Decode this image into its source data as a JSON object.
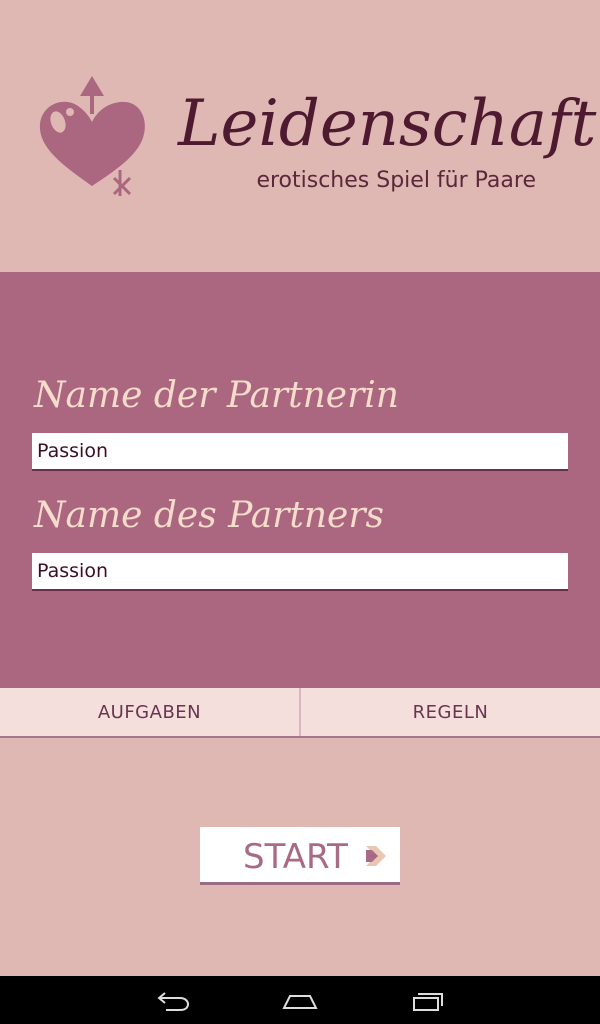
{
  "app": {
    "title": "Leidenschaft",
    "subtitle": "erotisches Spiel für Paare"
  },
  "form": {
    "partnerin_label": "Name der Partnerin",
    "partnerin_value": "Passion",
    "partner_label": "Name des Partners",
    "partner_value": "Passion"
  },
  "tabs": [
    {
      "label": "AUFGABEN"
    },
    {
      "label": "REGELN"
    }
  ],
  "start_button": {
    "label": "START"
  },
  "navbar": {
    "icons": [
      "back-icon",
      "home-icon",
      "recent-apps-icon"
    ]
  },
  "colors": {
    "background": "#dfb8b4",
    "panel": "#ab6780",
    "title": "#4e1a30",
    "label": "#f6dccb",
    "tab_bg": "#f4dfdd"
  }
}
